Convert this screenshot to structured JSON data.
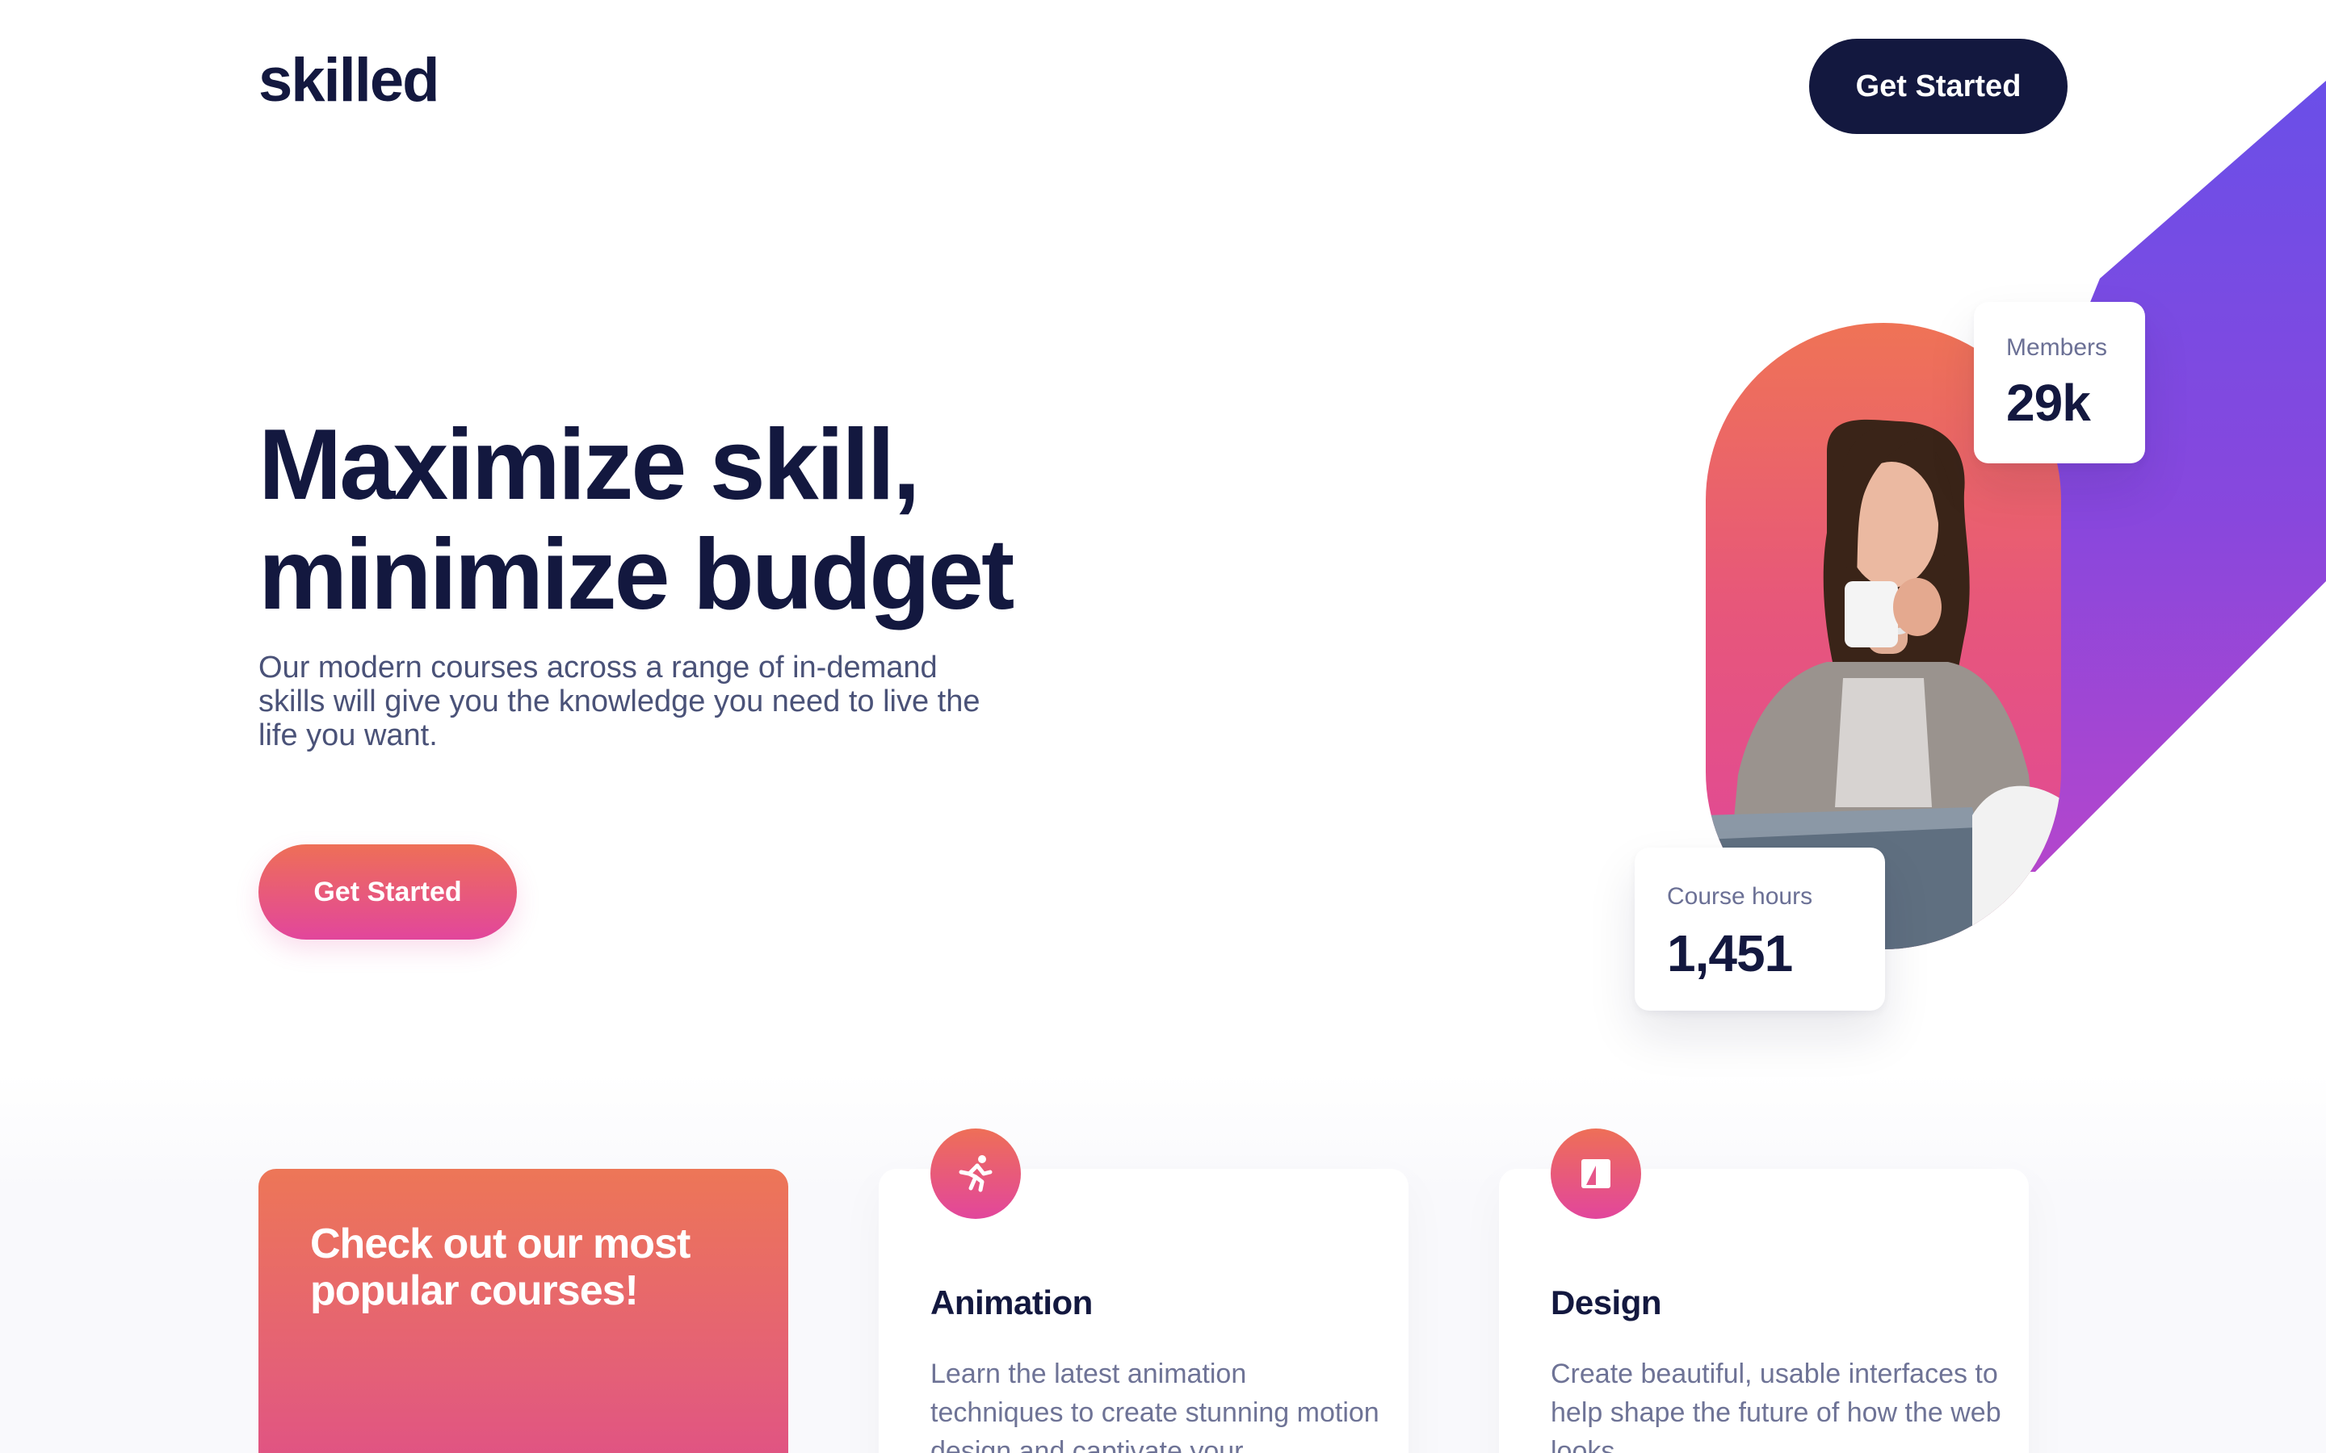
{
  "header": {
    "logo": "skilled",
    "cta_label": "Get Started"
  },
  "hero": {
    "title_line1": "Maximize skill,",
    "title_line2": "minimize budget",
    "subtitle": "Our modern courses across a range of in-demand skills will give you the knowledge you need to live the life you want.",
    "cta_label": "Get Started"
  },
  "stats": {
    "members_label": "Members",
    "members_value": "29k",
    "hours_label": "Course hours",
    "hours_value": "1,451"
  },
  "promo": {
    "title": "Check out our most popular courses!"
  },
  "courses": [
    {
      "icon": "running-person-icon",
      "title": "Animation",
      "description": "Learn the latest animation techniques to create stunning motion design and captivate your"
    },
    {
      "icon": "design-frame-icon",
      "title": "Design",
      "description": "Create beautiful, usable interfaces to help shape the future of how the web looks."
    }
  ],
  "colors": {
    "navy": "#13183f",
    "gradient_orange": "#ee6f57",
    "gradient_pink": "#e2469c",
    "diag_purple": "#6e4be6",
    "text_muted": "#4a5278"
  }
}
